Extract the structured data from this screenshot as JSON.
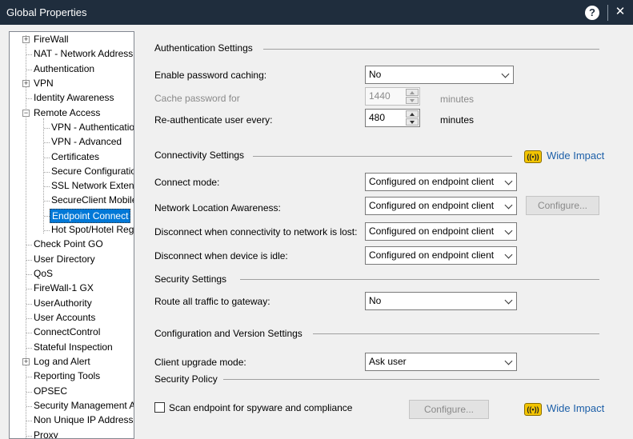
{
  "window": {
    "title": "Global Properties",
    "help_glyph": "?",
    "close_glyph": "✕"
  },
  "tree": {
    "items": [
      {
        "label": "FireWall",
        "expander": "+"
      },
      {
        "label": "NAT - Network Address Translation"
      },
      {
        "label": "Authentication"
      },
      {
        "label": "VPN",
        "expander": "+"
      },
      {
        "label": "Identity Awareness"
      },
      {
        "label": "Remote Access",
        "expander": "−"
      },
      {
        "label": "VPN - Authentication and Encryption"
      },
      {
        "label": "VPN - Advanced"
      },
      {
        "label": "Certificates"
      },
      {
        "label": "Secure Configuration Verification"
      },
      {
        "label": "SSL Network Extender"
      },
      {
        "label": "SecureClient Mobile"
      },
      {
        "label": "Endpoint Connect"
      },
      {
        "label": "Hot Spot/Hotel Registration"
      },
      {
        "label": "Check Point GO"
      },
      {
        "label": "User Directory"
      },
      {
        "label": "QoS"
      },
      {
        "label": "FireWall-1 GX"
      },
      {
        "label": "UserAuthority"
      },
      {
        "label": "User Accounts"
      },
      {
        "label": "ConnectControl"
      },
      {
        "label": "Stateful Inspection"
      },
      {
        "label": "Log and Alert",
        "expander": "+"
      },
      {
        "label": "Reporting Tools"
      },
      {
        "label": "OPSEC"
      },
      {
        "label": "Security Management Access"
      },
      {
        "label": "Non Unique IP Address Ranges"
      },
      {
        "label": "Proxy"
      }
    ]
  },
  "auth": {
    "heading": "Authentication Settings",
    "enable_caching_label": "Enable password caching:",
    "enable_caching_value": "No",
    "cache_for_label": "Cache password for",
    "cache_for_value": "1440",
    "cache_for_unit": "minutes",
    "reauth_label": "Re-authenticate user every:",
    "reauth_value": "480",
    "reauth_unit": "minutes"
  },
  "connectivity": {
    "heading": "Connectivity Settings",
    "wide_impact": "Wide Impact",
    "connect_mode_label": "Connect mode:",
    "connect_mode_value": "Configured on endpoint client",
    "nla_label": "Network Location Awareness:",
    "nla_value": "Configured on endpoint client",
    "configure_label": "Configure...",
    "disc_lost_label": "Disconnect when connectivity to network is lost:",
    "disc_lost_value": "Configured on endpoint client",
    "disc_idle_label": "Disconnect when device is idle:",
    "disc_idle_value": "Configured on endpoint client"
  },
  "security": {
    "heading": "Security Settings",
    "route_label": "Route all traffic to gateway:",
    "route_value": "No"
  },
  "config_version": {
    "heading": "Configuration and Version Settings",
    "upgrade_label": "Client upgrade mode:",
    "upgrade_value": "Ask user"
  },
  "policy": {
    "heading": "Security Policy",
    "scan_label": "Scan endpoint for spyware and compliance",
    "configure_label": "Configure...",
    "wide_impact": "Wide Impact"
  },
  "colors": {
    "titlebar": "#1f2d3d",
    "selection": "#0078d7",
    "link": "#1c5fa8",
    "impact_icon": "#f2c400"
  },
  "icons": {
    "wide_impact": "wireless-signal-icon"
  }
}
